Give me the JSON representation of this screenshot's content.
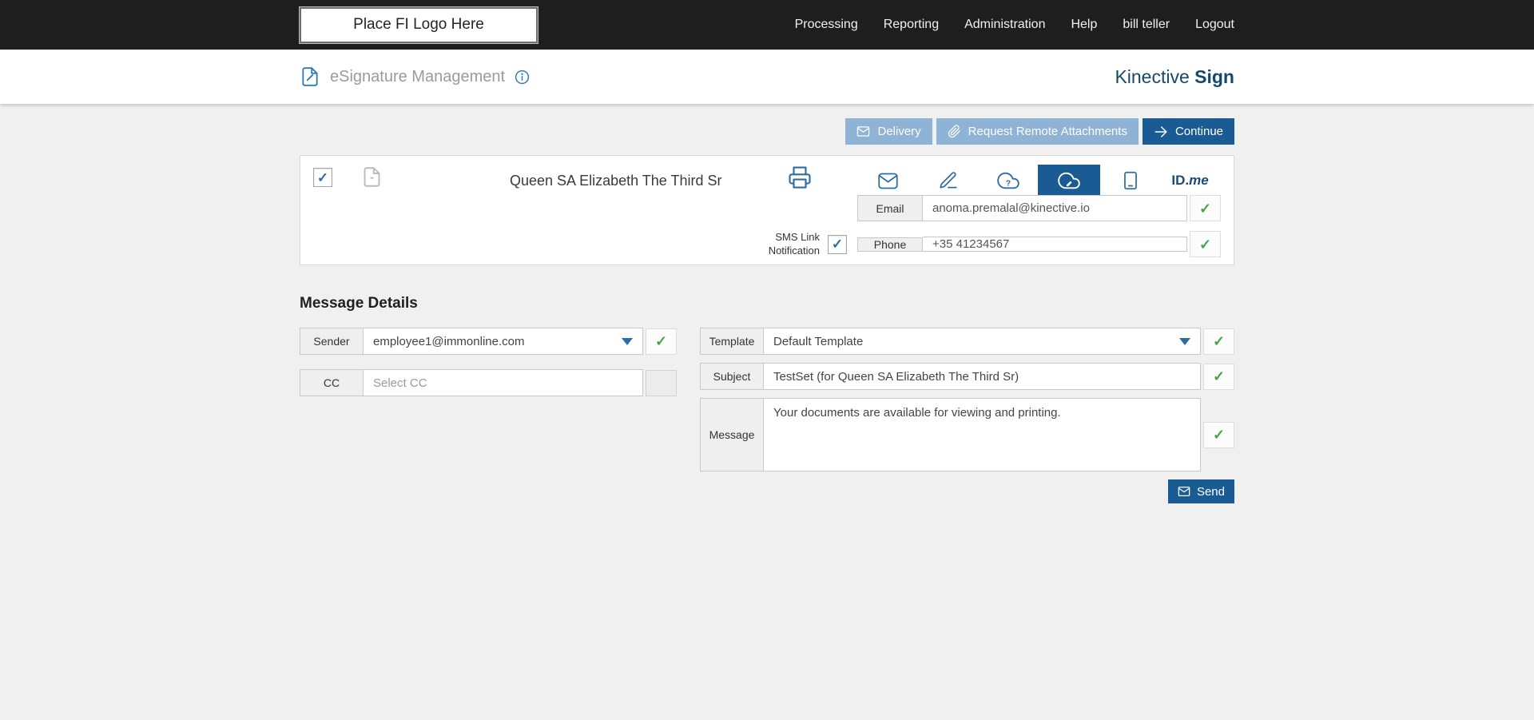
{
  "colors": {
    "topbar_bg": "#1e1e1e",
    "accent_blue": "#1a5b94",
    "light_blue_button": "#8eb3d5",
    "icon_blue": "#2d6da3",
    "brand_navy": "#16486e",
    "green_check": "#47a447",
    "page_bg": "#f0f0f0"
  },
  "topnav": {
    "logo_placeholder": "Place FI Logo Here",
    "items": [
      "Processing",
      "Reporting",
      "Administration",
      "Help",
      "bill teller",
      "Logout"
    ]
  },
  "header": {
    "title": "eSignature Management",
    "brand_regular": "Kinective",
    "brand_bold": "Sign"
  },
  "toolbar": {
    "delivery": "Delivery",
    "request_remote": "Request Remote Attachments",
    "continue": "Continue"
  },
  "recipient": {
    "selected": true,
    "name": "Queen SA Elizabeth The Third Sr",
    "selected_delivery": "cloud-signature",
    "email_label": "Email",
    "email_value": "anoma.premalal@kinective.io",
    "email_valid": true,
    "sms_link_label": "SMS Link Notification",
    "sms_enabled": true,
    "phone_label": "Phone",
    "phone_value": "+35 41234567",
    "phone_valid": true,
    "idme_bold": "ID.",
    "idme_italic": "me"
  },
  "message_details": {
    "heading": "Message Details",
    "sender_label": "Sender",
    "sender_value": "employee1@immonline.com",
    "cc_label": "CC",
    "cc_placeholder": "Select CC",
    "template_label": "Template",
    "template_value": "Default Template",
    "subject_label": "Subject",
    "subject_value": "TestSet (for Queen SA Elizabeth The Third Sr)",
    "message_label": "Message",
    "message_value": "Your documents are available for viewing and printing.",
    "send": "Send"
  },
  "glyphs": {
    "check": "✓"
  },
  "icons": {
    "header": "document-pen-icon",
    "header_info": "info-icon",
    "toolbar_delivery": "envelope-icon",
    "toolbar_attachments": "paperclip-icon",
    "toolbar_continue": "arrow-right-icon",
    "recipient_file": "document-icon",
    "recipient_print": "printer-icon",
    "delivery_methods": [
      "envelope-icon",
      "signature-pen-icon",
      "cloud-question-icon",
      "cloud-signature-icon",
      "kiosk-tablet-icon",
      "idme-logo"
    ],
    "validation": "green-check-icon",
    "send": "envelope-icon",
    "dropdown": "chevron-down-icon"
  }
}
